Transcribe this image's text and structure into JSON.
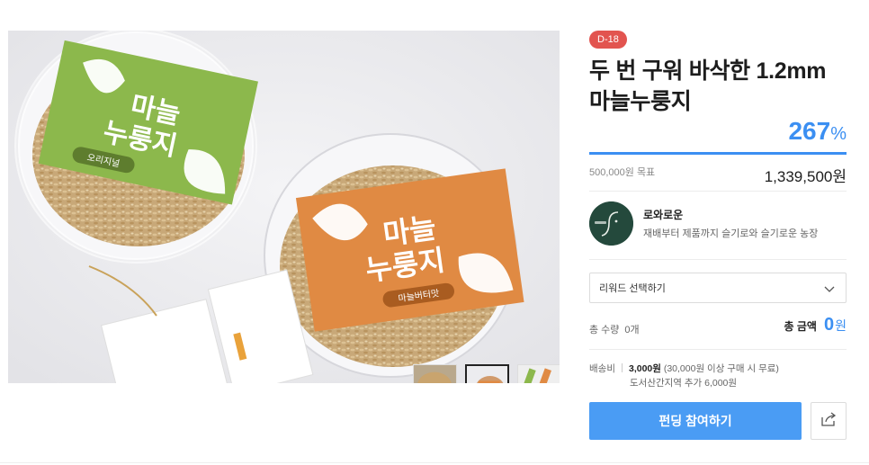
{
  "product": {
    "image_alt": "마늘누룽지",
    "thumbnails": [
      "thumb-1",
      "thumb-2",
      "thumb-3"
    ],
    "active_thumbnail": 1,
    "package_green_brand": "마늘\n누룽지",
    "package_green_flavor": "오리지널",
    "package_orange_brand": "마늘\n누룽지",
    "package_orange_flavor": "마늘버터맛"
  },
  "funding": {
    "dday": "D-18",
    "title": "두 번 구워 바삭한 1.2mm 마늘누룽지",
    "percent": "267",
    "percent_unit": "%",
    "progress_fraction": 1.0,
    "goal_text": "500,000원 목표",
    "amount_text": "1,339,500원"
  },
  "maker": {
    "name": "로와로운",
    "description": "재배부터 제품까지 슬기로와 슬기로운 농장",
    "avatar_icon": "maker-logo-icon"
  },
  "reward": {
    "select_label": "리워드 선택하기",
    "quantity_label": "총 수량",
    "quantity_value": "0개",
    "total_label": "총 금액",
    "total_value": "0",
    "total_unit": "원"
  },
  "shipping": {
    "label": "배송비",
    "fee": "3,000원",
    "note": "(30,000원 이상 구매 시 무료)",
    "extra": "도서산간지역 추가 6,000원"
  },
  "actions": {
    "fund_button": "펀딩 참여하기",
    "share_icon": "share-icon"
  },
  "colors": {
    "accent": "#3b8ff2",
    "button": "#4a9cf4",
    "dday_badge": "#e2544f",
    "package_green": "#8cb84c",
    "package_orange": "#e08a43"
  }
}
